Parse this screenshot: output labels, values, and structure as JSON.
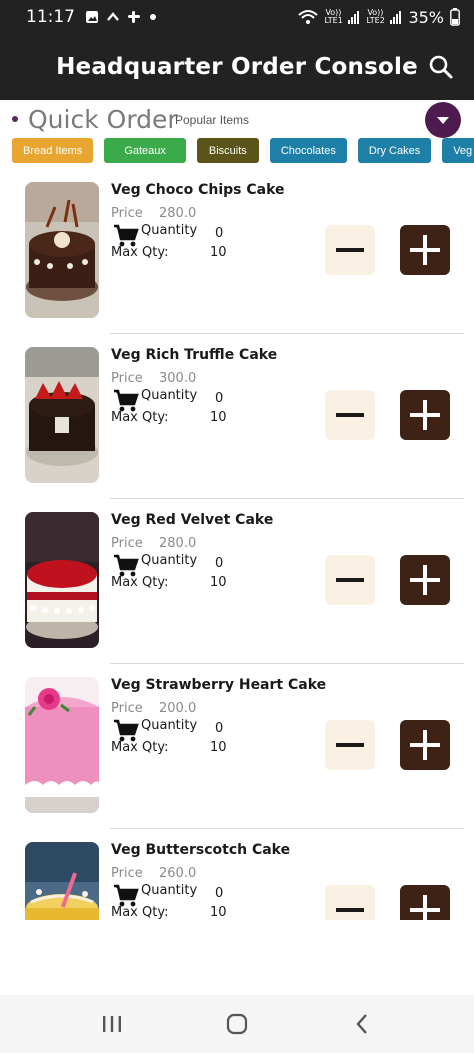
{
  "status_bar": {
    "time": "11:17",
    "battery": "35%",
    "sim1": "Vo)) LTE1",
    "sim2": "Vo)) LTE2",
    "left_icons": [
      "gallery-icon",
      "caret-up-icon",
      "slack-icon",
      "dot-icon"
    ],
    "right_icons": [
      "wifi-icon",
      "signal-icon",
      "signal-icon",
      "battery-icon"
    ]
  },
  "header": {
    "title": "Headquarter Order Console",
    "search_icon": "search-icon"
  },
  "quick_order": {
    "title": "Quick Order",
    "subtitle": "Popular Items",
    "dropdown_icon": "caret-down-icon"
  },
  "categories": [
    {
      "label": "Bread Items",
      "color": "#e8a530"
    },
    {
      "label": "Gateaux",
      "color": "#3aaa4a"
    },
    {
      "label": "Biscuits",
      "color": "#5b5418"
    },
    {
      "label": "Chocolates",
      "color": "#1e7fa8"
    },
    {
      "label": "Dry Cakes",
      "color": "#1e7fa8"
    },
    {
      "label": "Veg Savo",
      "color": "#1e7fa8"
    }
  ],
  "labels": {
    "price": "Price",
    "quantity": "Quantity",
    "max_qty": "Max Qty:"
  },
  "products": [
    {
      "name": "Veg Choco Chips Cake",
      "price": "280.0",
      "quantity": "0",
      "max_qty": "10"
    },
    {
      "name": "Veg Rich Truffle Cake",
      "price": "300.0",
      "quantity": "0",
      "max_qty": "10"
    },
    {
      "name": "Veg Red Velvet Cake",
      "price": "280.0",
      "quantity": "0",
      "max_qty": "10"
    },
    {
      "name": "Veg Strawberry Heart Cake",
      "price": "200.0",
      "quantity": "0",
      "max_qty": "10"
    },
    {
      "name": "Veg Butterscotch Cake",
      "price": "260.0",
      "quantity": "0",
      "max_qty": "10"
    }
  ],
  "nav": {
    "icons": [
      "recents-icon",
      "home-icon",
      "back-icon"
    ]
  }
}
